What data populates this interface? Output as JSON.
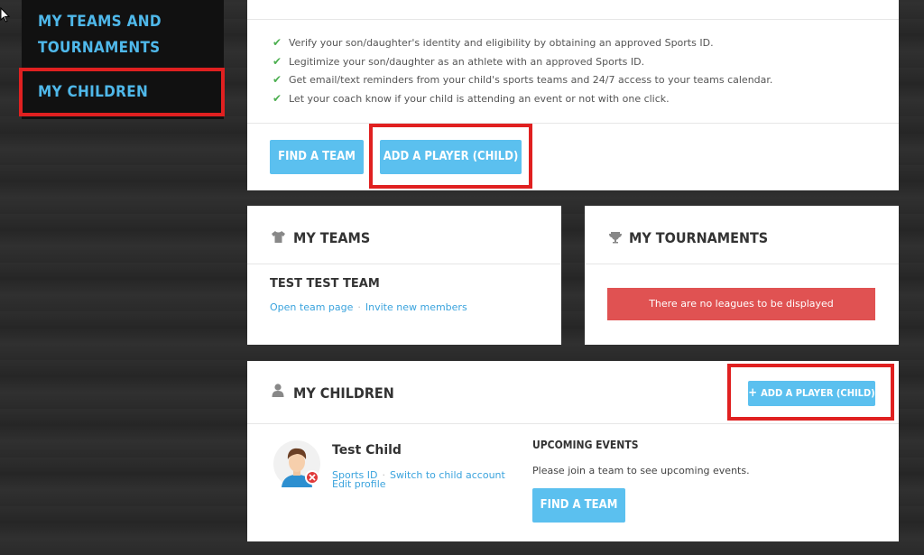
{
  "sidebar": {
    "items": [
      {
        "label": "MY TEAMS AND TOURNAMENTS"
      },
      {
        "label": "MY CHILDREN"
      }
    ]
  },
  "intro": {
    "benefits": [
      "Verify your son/daughter's identity and eligibility by obtaining an approved Sports ID.",
      "Legitimize your son/daughter as an athlete with an approved Sports ID.",
      "Get email/text reminders from your child's sports teams and 24/7 access to your teams calendar.",
      "Let your coach know if your child is attending an event or not with one click."
    ],
    "find_team_label": "FIND A TEAM",
    "add_player_label": "ADD A PLAYER (CHILD)"
  },
  "my_teams": {
    "title": "MY TEAMS",
    "team_name": "TEST TEST TEAM",
    "open_team_link": "Open team page",
    "separator": "·",
    "invite_link": "Invite new members"
  },
  "my_tournaments": {
    "title": "MY TOURNAMENTS",
    "empty_message": "There are no leagues to be displayed"
  },
  "my_children": {
    "title": "MY CHILDREN",
    "add_player_label": "ADD A PLAYER (CHILD)",
    "child_name": "Test Child",
    "sports_id_link": "Sports ID",
    "separator": "·",
    "switch_link": "Switch to child account",
    "edit_profile_link": "Edit profile",
    "upcoming_title": "UPCOMING EVENTS",
    "upcoming_message": "Please join a team to see upcoming events.",
    "find_team_label": "FIND A TEAM"
  },
  "colors": {
    "accent": "#5bc0ef",
    "highlight": "#e02020",
    "alert": "#e05252",
    "sidebar_text": "#4fb8ea"
  }
}
